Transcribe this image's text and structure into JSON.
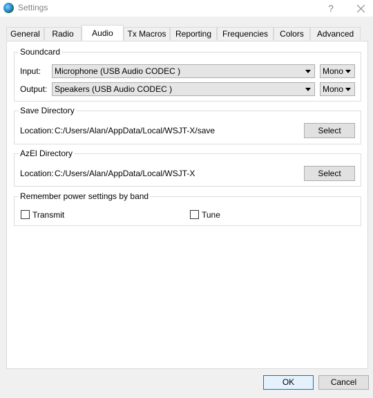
{
  "window": {
    "title": "Settings",
    "help_label": "?"
  },
  "tabs": [
    {
      "label": "General"
    },
    {
      "label": "Radio"
    },
    {
      "label": "Audio"
    },
    {
      "label": "Tx Macros"
    },
    {
      "label": "Reporting"
    },
    {
      "label": "Frequencies"
    },
    {
      "label": "Colors"
    },
    {
      "label": "Advanced"
    }
  ],
  "active_tab": "Audio",
  "soundcard": {
    "title": "Soundcard",
    "input_label": "Input:",
    "input_device": "Microphone (USB Audio CODEC )",
    "input_channel": "Mono",
    "output_label": "Output:",
    "output_device": "Speakers (USB Audio CODEC )",
    "output_channel": "Mono"
  },
  "save_directory": {
    "title": "Save Directory",
    "location_label": "Location:",
    "path": "C:/Users/Alan/AppData/Local/WSJT-X/save",
    "select_label": "Select"
  },
  "azel_directory": {
    "title": "AzEl Directory",
    "location_label": "Location:",
    "path": "C:/Users/Alan/AppData/Local/WSJT-X",
    "select_label": "Select"
  },
  "power_settings": {
    "title": "Remember power settings by band",
    "transmit_label": "Transmit",
    "transmit_checked": false,
    "tune_label": "Tune",
    "tune_checked": false
  },
  "footer": {
    "ok_label": "OK",
    "cancel_label": "Cancel"
  }
}
